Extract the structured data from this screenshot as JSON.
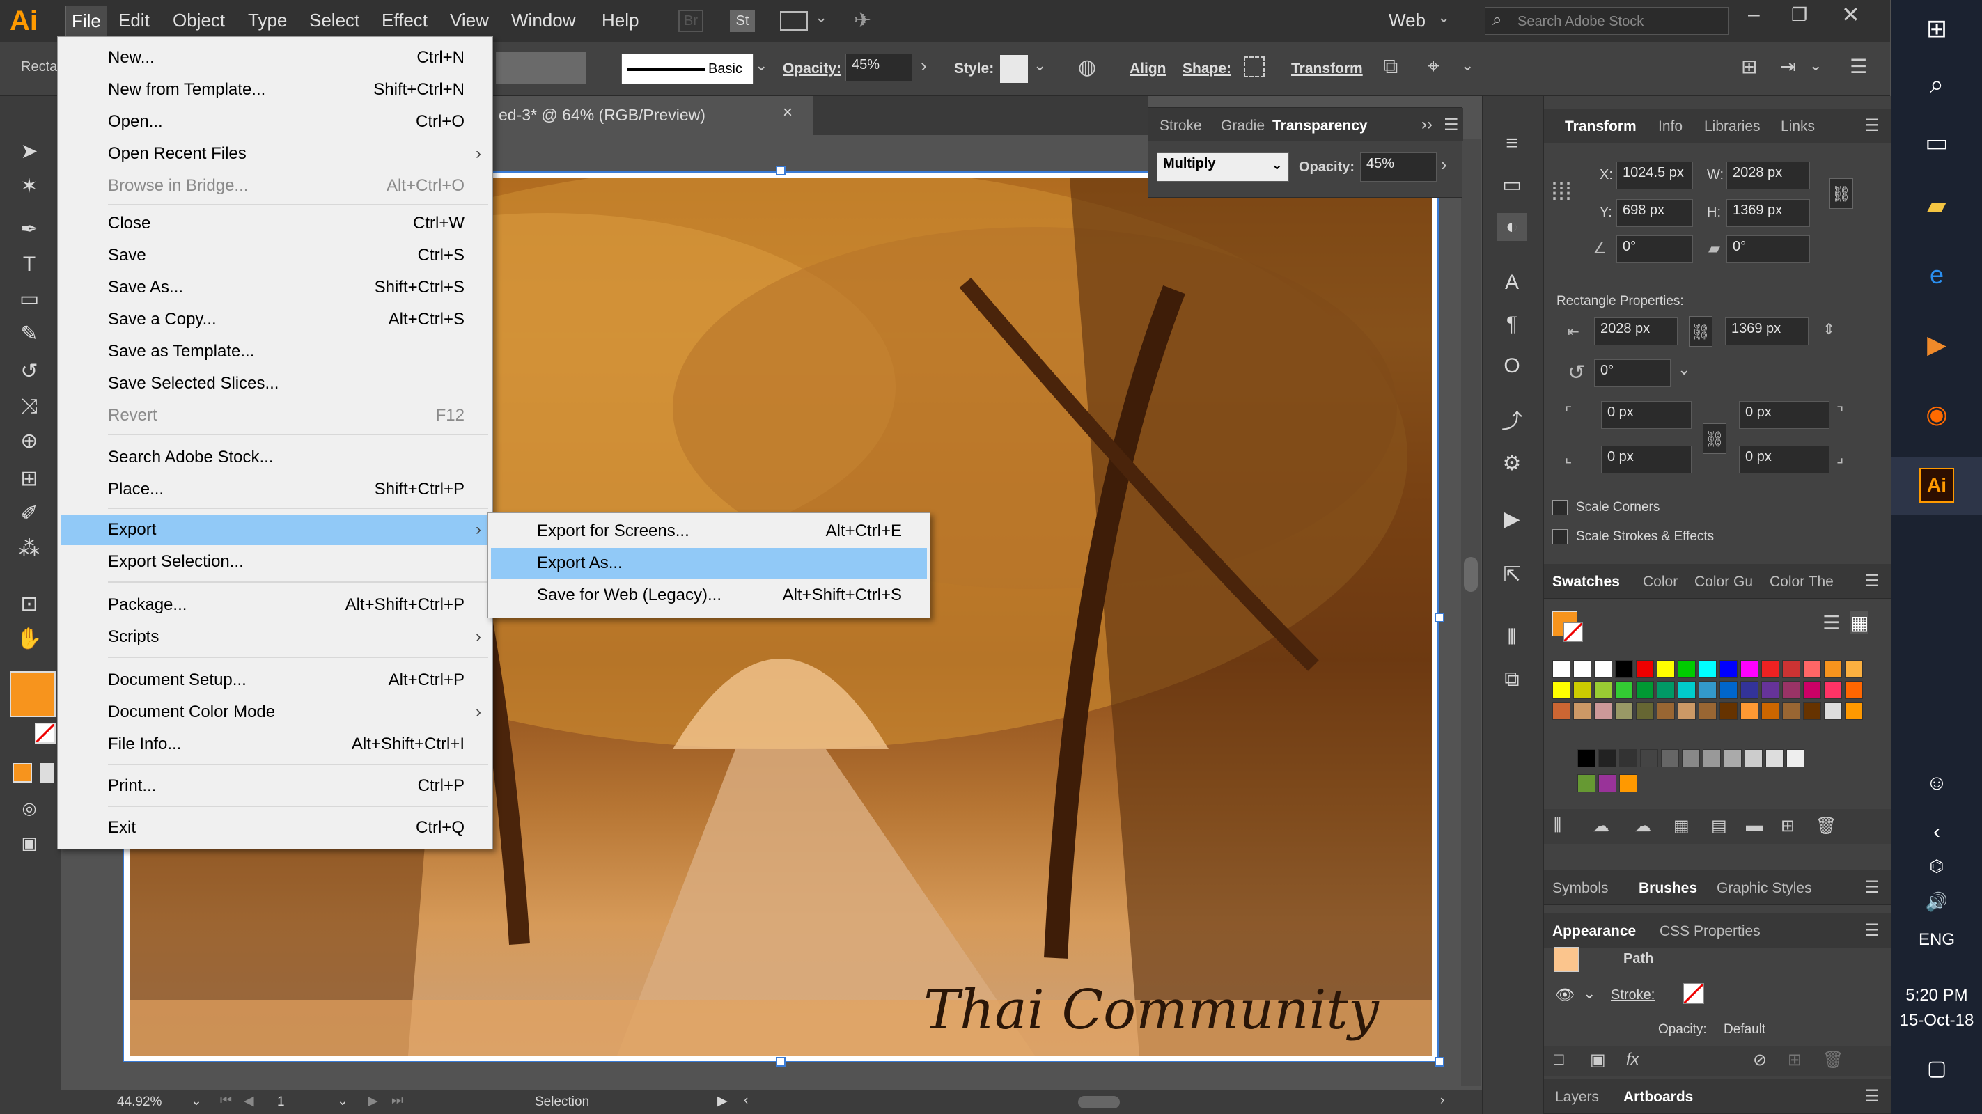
{
  "app": {
    "logo": "Ai"
  },
  "menubar": {
    "items": [
      "File",
      "Edit",
      "Object",
      "Type",
      "Select",
      "Effect",
      "View",
      "Window",
      "Help"
    ],
    "workspace": "Web",
    "search_placeholder": "Search Adobe Stock",
    "br": "Br",
    "st": "St"
  },
  "control": {
    "tool_label": "Recta",
    "stroke_style": "Basic",
    "opacity_label": "Opacity:",
    "opacity_value": "45%",
    "style_label": "Style:",
    "align": "Align",
    "shape": "Shape:",
    "transform": "Transform"
  },
  "document": {
    "tab_title": "ed-3* @ 64% (RGB/Preview)",
    "watermark": "Thai Community"
  },
  "status": {
    "zoom": "44.92%",
    "page": "1",
    "tool": "Selection"
  },
  "transparency_panel": {
    "tabs": [
      "Stroke",
      "Gradie",
      "Transparency"
    ],
    "blend_mode": "Multiply",
    "opacity_label": "Opacity:",
    "opacity_value": "45%"
  },
  "transform_panel": {
    "tabs": [
      "Transform",
      "Info",
      "Libraries",
      "Links"
    ],
    "x_label": "X:",
    "x": "1024.5 px",
    "y_label": "Y:",
    "y": "698 px",
    "w_label": "W:",
    "w": "2028 px",
    "h_label": "H:",
    "h": "1369 px",
    "angle": "0°",
    "shear": "0°",
    "rect_props": "Rectangle Properties:",
    "rw": "2028 px",
    "rh": "1369 px",
    "rangle": "0°",
    "r1": "0 px",
    "r2": "0 px",
    "r3": "0 px",
    "r4": "0 px",
    "scale_corners": "Scale Corners",
    "scale_strokes": "Scale Strokes & Effects"
  },
  "swatches_panel": {
    "tabs": [
      "Swatches",
      "Color",
      "Color Gu",
      "Color The"
    ]
  },
  "brushes_panel": {
    "tabs": [
      "Symbols",
      "Brushes",
      "Graphic Styles"
    ]
  },
  "appearance_panel": {
    "tabs": [
      "Appearance",
      "CSS Properties"
    ],
    "path": "Path",
    "stroke": "Stroke:",
    "opacity": "Opacity:",
    "opacity_value": "Default"
  },
  "layers_panel": {
    "tabs": [
      "Layers",
      "Artboards"
    ]
  },
  "file_menu": [
    {
      "label": "New...",
      "shortcut": "Ctrl+N"
    },
    {
      "label": "New from Template...",
      "shortcut": "Shift+Ctrl+N"
    },
    {
      "label": "Open...",
      "shortcut": "Ctrl+O"
    },
    {
      "label": "Open Recent Files",
      "shortcut": "",
      "arrow": "›"
    },
    {
      "label": "Browse in Bridge...",
      "shortcut": "Alt+Ctrl+O"
    },
    {
      "label": "Close",
      "shortcut": "Ctrl+W"
    },
    {
      "label": "Save",
      "shortcut": "Ctrl+S"
    },
    {
      "label": "Save As...",
      "shortcut": "Shift+Ctrl+S"
    },
    {
      "label": "Save a Copy...",
      "shortcut": "Alt+Ctrl+S"
    },
    {
      "label": "Save as Template...",
      "shortcut": ""
    },
    {
      "label": "Save Selected Slices...",
      "shortcut": ""
    },
    {
      "label": "Revert",
      "shortcut": "F12"
    },
    {
      "label": "Search Adobe Stock...",
      "shortcut": ""
    },
    {
      "label": "Place...",
      "shortcut": "Shift+Ctrl+P"
    },
    {
      "label": "Export",
      "shortcut": "",
      "arrow": "›"
    },
    {
      "label": "Export Selection...",
      "shortcut": ""
    },
    {
      "label": "Package...",
      "shortcut": "Alt+Shift+Ctrl+P"
    },
    {
      "label": "Scripts",
      "shortcut": "",
      "arrow": "›"
    },
    {
      "label": "Document Setup...",
      "shortcut": "Alt+Ctrl+P"
    },
    {
      "label": "Document Color Mode",
      "shortcut": "",
      "arrow": "›"
    },
    {
      "label": "File Info...",
      "shortcut": "Alt+Shift+Ctrl+I"
    },
    {
      "label": "Print...",
      "shortcut": "Ctrl+P"
    },
    {
      "label": "Exit",
      "shortcut": "Ctrl+Q"
    }
  ],
  "export_submenu": [
    {
      "label": "Export for Screens...",
      "shortcut": "Alt+Ctrl+E"
    },
    {
      "label": "Export As...",
      "shortcut": ""
    },
    {
      "label": "Save for Web (Legacy)...",
      "shortcut": "Alt+Shift+Ctrl+S"
    }
  ],
  "taskbar": {
    "lang": "ENG",
    "time": "5:20 PM",
    "date": "15-Oct-18",
    "ai": "Ai"
  },
  "colors": {
    "accent": "#f7941d",
    "highlight": "#91c9f7"
  }
}
